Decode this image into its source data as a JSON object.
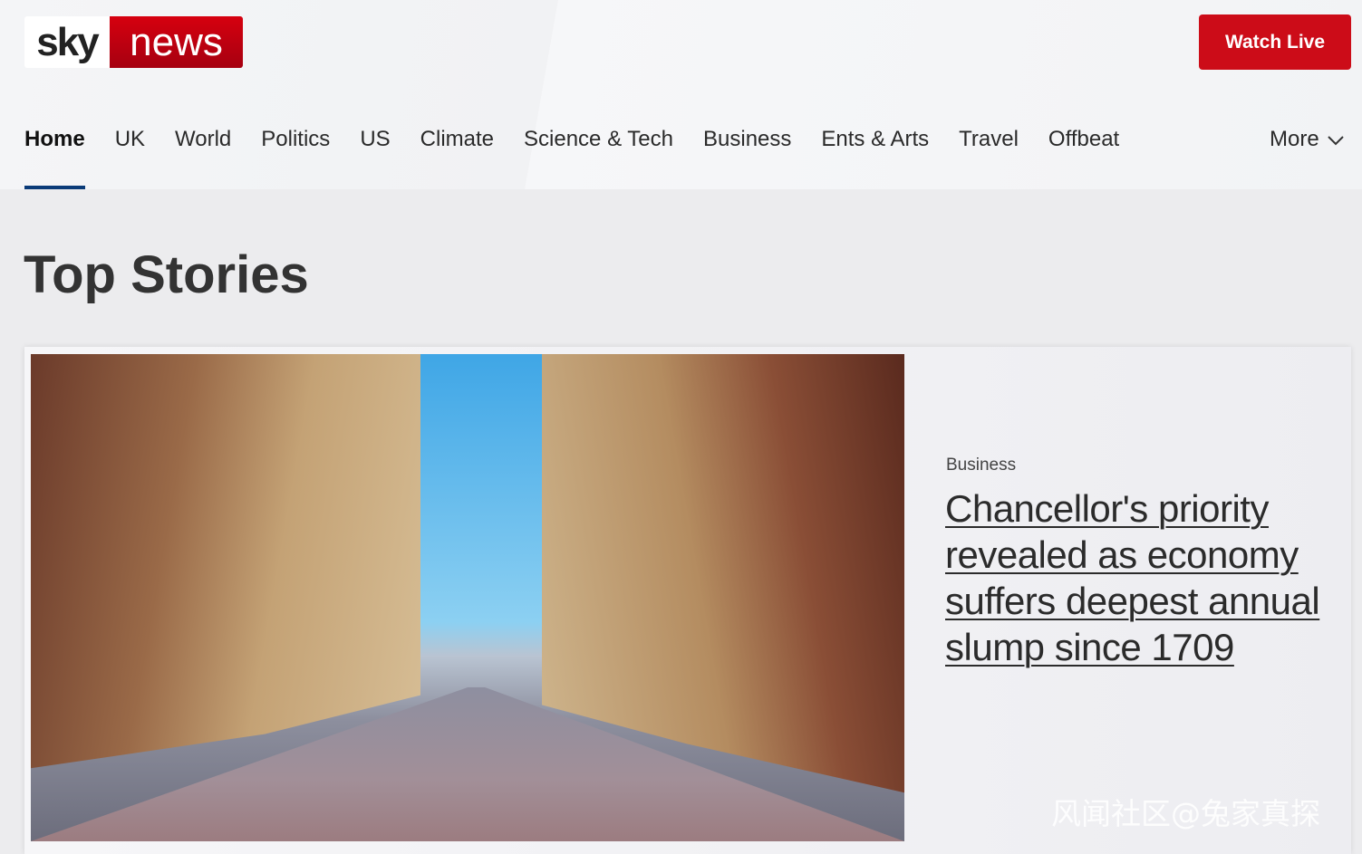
{
  "header": {
    "logo_sky": "sky",
    "logo_news": "news",
    "watch_live": "Watch Live"
  },
  "nav": {
    "items": [
      "Home",
      "UK",
      "World",
      "Politics",
      "US",
      "Climate",
      "Science & Tech",
      "Business",
      "Ents & Arts",
      "Travel",
      "Offbeat"
    ],
    "more": "More"
  },
  "section_title": "Top Stories",
  "lead_story": {
    "category": "Business",
    "headline": "Chancellor's priority revealed as economy suffers deepest annual slump since 1709"
  },
  "watermark": "风闻社区@兔家真探"
}
